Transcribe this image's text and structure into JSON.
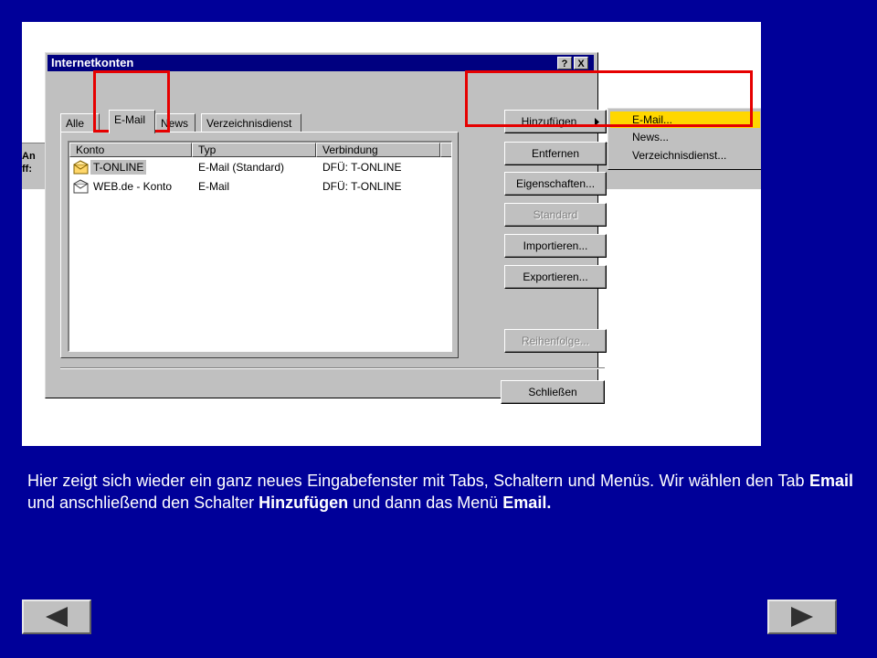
{
  "dialog": {
    "title": "Internetkonten",
    "help_btn": "?",
    "close_btn": "X",
    "tabs": [
      "Alle",
      "E-Mail",
      "News",
      "Verzeichnisdienst"
    ],
    "columns": [
      "Konto",
      "Typ",
      "Verbindung"
    ],
    "rows": [
      {
        "account": "T-ONLINE",
        "type": "E-Mail (Standard)",
        "connection": "DFÜ: T-ONLINE"
      },
      {
        "account": "WEB.de - Konto",
        "type": "E-Mail",
        "connection": "DFÜ: T-ONLINE"
      }
    ],
    "buttons": {
      "add": "Hinzufügen",
      "remove": "Entfernen",
      "properties": "Eigenschaften...",
      "default": "Standard",
      "import": "Importieren...",
      "export": "Exportieren...",
      "order": "Reihenfolge...",
      "close": "Schließen"
    },
    "menu": [
      "E-Mail...",
      "News...",
      "Verzeichnisdienst..."
    ]
  },
  "background_fragment": [
    "An",
    "ff:"
  ],
  "caption": {
    "line1": "Hier zeigt sich wieder ein ganz neues Eingabefenster mit Tabs, Schaltern und Menüs.",
    "line2_a": "Wir wählen den Tab ",
    "line2_b": "Email",
    "line2_c": " und anschließend den Schalter ",
    "line2_d": "Hinzufügen",
    "line2_e": " und dann das Menü ",
    "line2_f": "Email."
  },
  "nav": {
    "prev_icon": "arrow-left-icon",
    "next_icon": "arrow-right-icon"
  },
  "colors": {
    "slide_bg": "#000099",
    "titlebar": "#000080",
    "highlight": "#ffd700",
    "annotation": "#e60000"
  }
}
